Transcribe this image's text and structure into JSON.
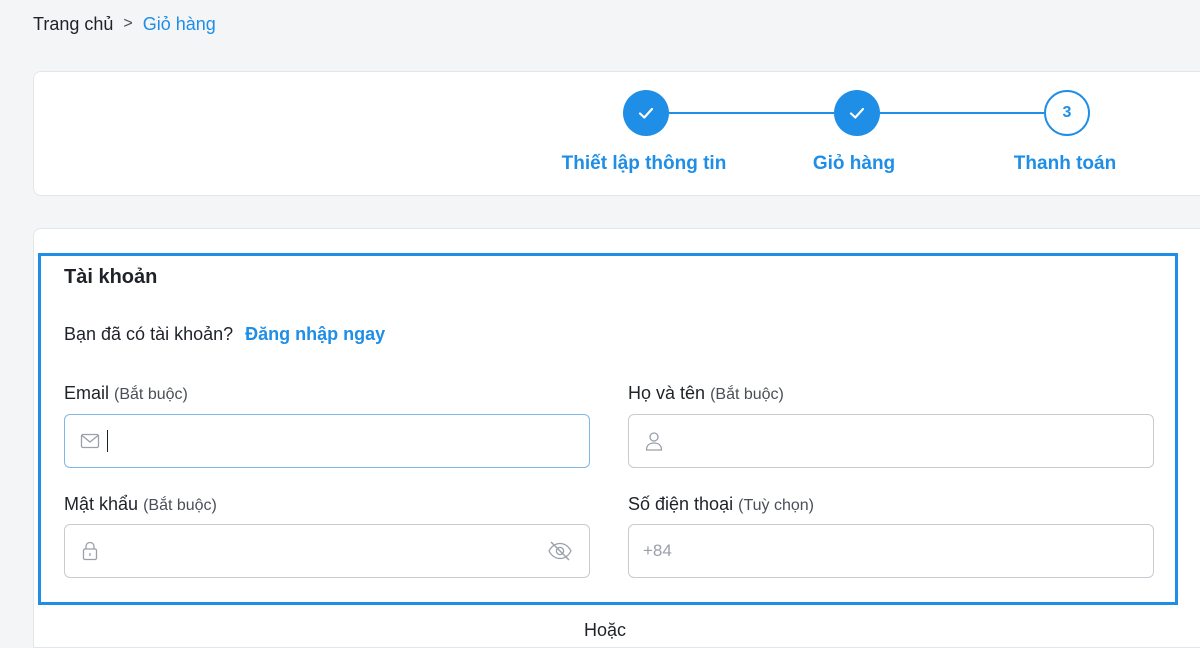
{
  "breadcrumb": {
    "home": "Trang chủ",
    "separator": ">",
    "current": "Giỏ hàng"
  },
  "stepper": {
    "steps": [
      {
        "label": "Thiết lập thông tin",
        "state": "done"
      },
      {
        "label": "Giỏ hàng",
        "state": "done"
      },
      {
        "label": "Thanh toán",
        "state": "pending",
        "number": "3"
      }
    ]
  },
  "account": {
    "title": "Tài khoản",
    "login_prompt": "Bạn đã có tài khoản?",
    "login_link": "Đăng nhập ngay",
    "email": {
      "label": "Email",
      "hint": "(Bắt buộc)",
      "value": "",
      "placeholder": ""
    },
    "fullname": {
      "label": "Họ và tên",
      "hint": "(Bắt buộc)",
      "value": "",
      "placeholder": ""
    },
    "password": {
      "label": "Mật khẩu",
      "hint": "(Bắt buộc)",
      "value": "",
      "placeholder": ""
    },
    "phone": {
      "label": "Số điện thoại",
      "hint": "(Tuỳ chọn)",
      "value": "",
      "placeholder": "+84"
    },
    "or_text": "Hoặc"
  },
  "colors": {
    "accent": "#1f8ee6",
    "border": "#c7ccd3",
    "text": "#1f2329"
  },
  "icons": {
    "email": "mail-icon",
    "fullname": "user-icon",
    "password": "lock-icon",
    "toggle": "eye-off-icon",
    "check": "check-icon"
  }
}
